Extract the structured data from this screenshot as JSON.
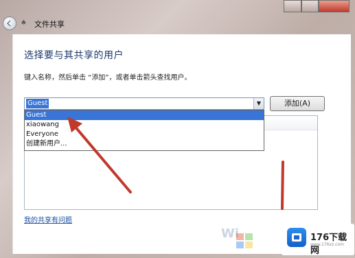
{
  "window": {
    "title": "文件共享",
    "title_icon": "share-icon"
  },
  "main": {
    "heading": "选择要与其共享的用户",
    "hint": "键入名称，然后单击 “添加”，或者单击箭头查找用户。",
    "combo_value": "Guest",
    "add_button": "添加(A)",
    "dropdown_items": [
      {
        "label": "Guest",
        "selected": true
      },
      {
        "label": "xiaowang",
        "selected": false
      },
      {
        "label": "Everyone",
        "selected": false
      },
      {
        "label": "创建新用户...",
        "selected": false
      }
    ],
    "share_link": "我的共享有问题"
  },
  "watermark": {
    "brand": "176下载网",
    "sub": "www.176xz.com",
    "faded": "Wi"
  },
  "colors": {
    "accent": "#3875d7",
    "arrow": "#c0392b",
    "heading": "#1b3a6b"
  }
}
